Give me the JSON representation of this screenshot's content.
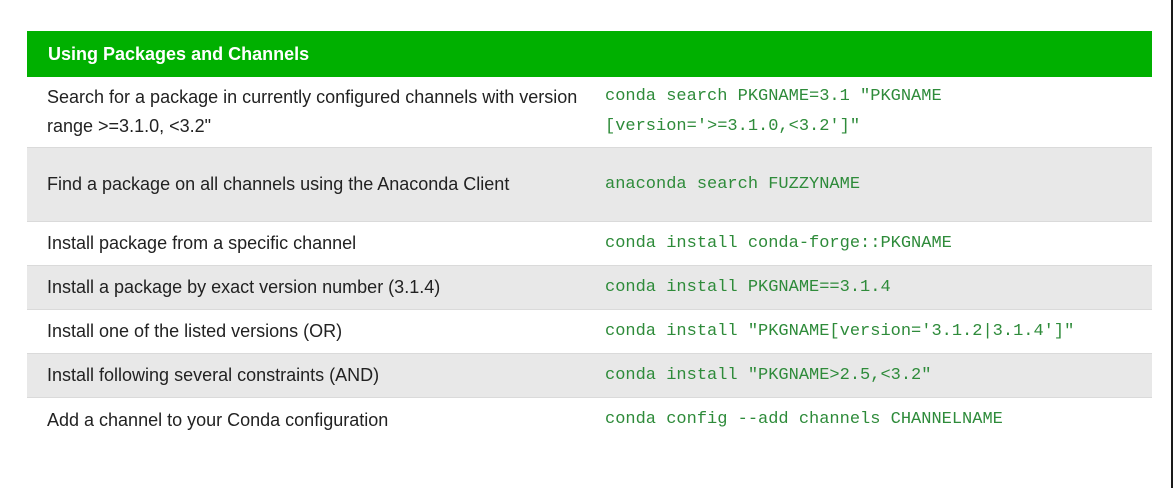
{
  "section": {
    "title": "Using Packages and Channels"
  },
  "rows": [
    {
      "description": "Search for a package in currently configured channels with version range >=3.1.0, <3.2\"",
      "command": "conda search PKGNAME=3.1 \"PKGNAME\n[version='>=3.1.0,<3.2']\""
    },
    {
      "description": "Find a package on all channels using the Anaconda Client",
      "command": "anaconda search FUZZYNAME"
    },
    {
      "description": "Install package from a specific channel",
      "command": "conda install conda-forge::PKGNAME"
    },
    {
      "description": "Install a package by exact version number (3.1.4)",
      "command": "conda install PKGNAME==3.1.4"
    },
    {
      "description": "Install one of the listed versions (OR)",
      "command": "conda install \"PKGNAME[version='3.1.2|3.1.4']\""
    },
    {
      "description": "Install following several constraints (AND)",
      "command": "conda install \"PKGNAME>2.5,<3.2\""
    },
    {
      "description": "Add a channel to your Conda configuration",
      "command": "conda config --add channels CHANNELNAME"
    }
  ],
  "colors": {
    "header_bg": "#00b000",
    "command_text": "#2e8b3a",
    "alt_row_bg": "#e8e8e8"
  }
}
